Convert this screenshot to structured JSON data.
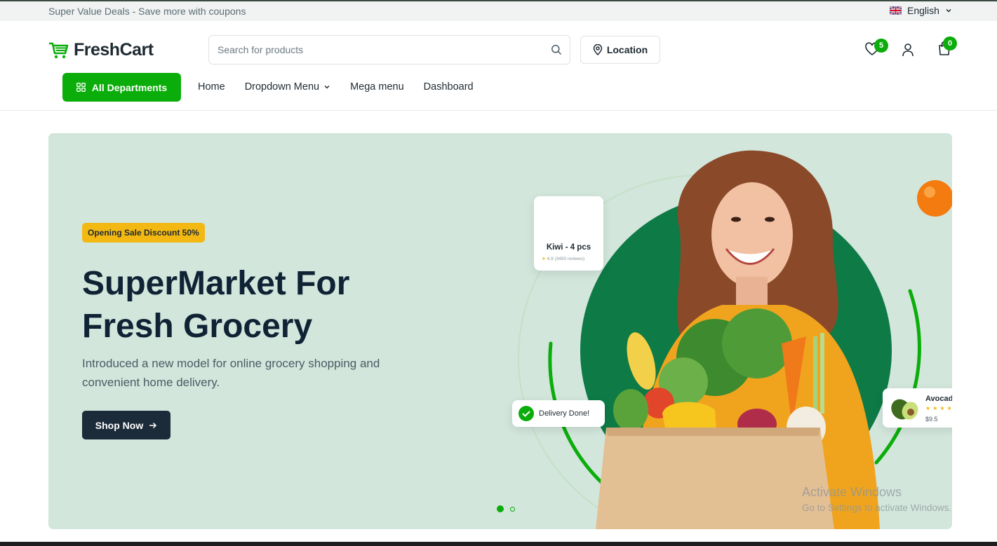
{
  "topbar": {
    "promo_text": "Super Value Deals - Save more with coupons",
    "language": "English",
    "flag_icon": "uk-flag-icon"
  },
  "header": {
    "logo_text": "FreshCart",
    "search": {
      "placeholder": "Search for products",
      "value": ""
    },
    "location_label": "Location",
    "wishlist_count": "5",
    "cart_count": "0"
  },
  "nav": {
    "departments_label": "All Departments",
    "items": [
      {
        "label": "Home"
      },
      {
        "label": "Dropdown Menu"
      },
      {
        "label": "Mega menu"
      },
      {
        "label": "Dashboard"
      }
    ]
  },
  "hero": {
    "badge": "Opening Sale Discount 50%",
    "title_line1": "SuperMarket For",
    "title_line2": "Fresh Grocery",
    "subtitle": "Introduced a new model for online grocery shopping and convenient home delivery.",
    "cta_label": "Shop Now",
    "slide_count": 2,
    "active_slide": 1,
    "kiwi_card": {
      "name": "Kiwi - 4 pcs",
      "rating": "4.9",
      "reviews": "(3450 reviews)"
    },
    "delivery_card": {
      "text": "Delivery Done!"
    },
    "avocado_card": {
      "name": "Avocado",
      "price": "$9.5"
    }
  },
  "watermark": {
    "title": "Activate Windows",
    "subtitle": "Go to Settings to activate Windows."
  },
  "colors": {
    "brand_green": "#0aad0a",
    "hero_bg": "#d2e6dc",
    "badge_yellow": "#f3b811",
    "dark_button": "#1c2b39"
  }
}
